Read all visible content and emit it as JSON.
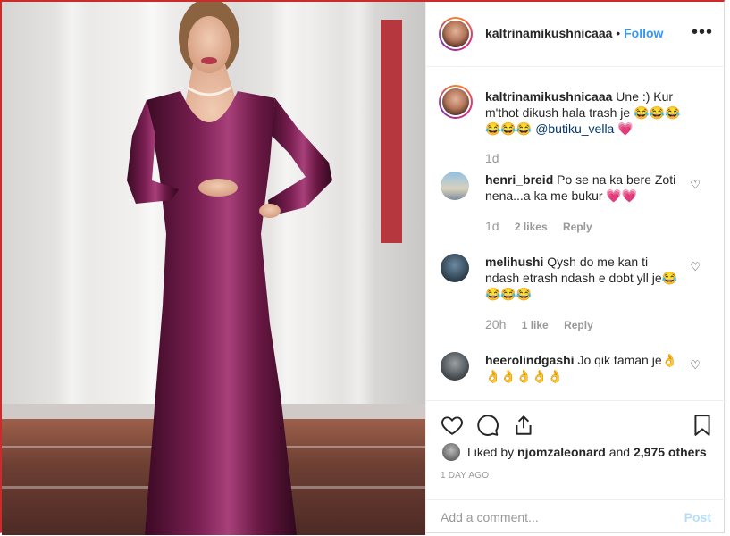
{
  "header": {
    "username": "kaltrinamikushnicaaa",
    "separator": "•",
    "follow_label": "Follow",
    "more_icon": "ellipsis-icon"
  },
  "caption": {
    "username": "kaltrinamikushnicaaa",
    "text": "Une :) Kur m'thot dikush hala trash je",
    "emoji": "😂😂😂😂😂😂",
    "mention": "@butiku_vella",
    "trail": "💗",
    "time": "1d"
  },
  "comments": [
    {
      "username": "henri_breid",
      "text": "Po se na ka bere Zoti nena...a ka me bukur 💗💗",
      "time": "1d",
      "likes": "2 likes",
      "reply": "Reply"
    },
    {
      "username": "melihushi",
      "text": "Qysh do me kan ti ndash etrash ndash e dobt yll je😂😂😂😂",
      "time": "20h",
      "likes": "1 like",
      "reply": "Reply"
    },
    {
      "username": "heerolindgashi",
      "text": "Jo qik taman je👌👌👌👌👌👌",
      "time": "",
      "likes": "",
      "reply": ""
    }
  ],
  "actions": {
    "icons": [
      "heart-icon",
      "comment-icon",
      "share-icon",
      "bookmark-icon"
    ],
    "liked_prefix": "Liked by",
    "liked_user": "njomzaleonard",
    "liked_mid": "and",
    "liked_count": "2,975 others",
    "date": "1 DAY AGO"
  },
  "add_comment": {
    "placeholder": "Add a comment...",
    "post_label": "Post"
  },
  "colors": {
    "accent": "#3897f0",
    "dress": "#5c1238",
    "border": "#efefef"
  }
}
